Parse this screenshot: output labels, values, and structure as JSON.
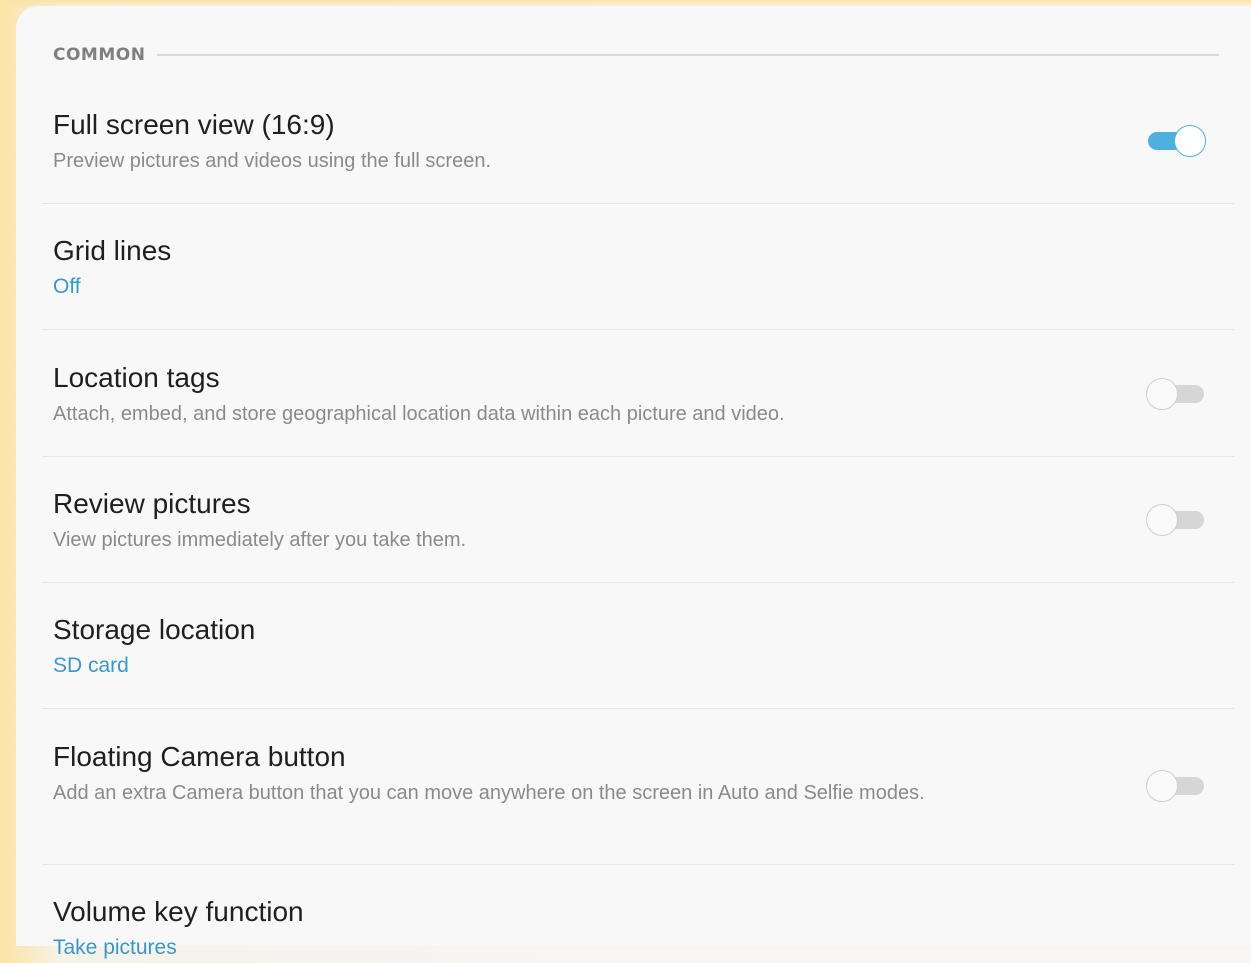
{
  "section": {
    "title": "COMMON"
  },
  "settings": [
    {
      "title": "Full screen view (16:9)",
      "description": "Preview pictures and videos using the full screen.",
      "toggle": "on"
    },
    {
      "title": "Grid lines",
      "value": "Off"
    },
    {
      "title": "Location tags",
      "description": "Attach, embed, and store geographical location data within each picture and video.",
      "toggle": "off"
    },
    {
      "title": "Review pictures",
      "description": "View pictures immediately after you take them.",
      "toggle": "off"
    },
    {
      "title": "Storage location",
      "value": "SD card"
    },
    {
      "title": "Floating Camera button",
      "description": "Add an extra Camera button that you can move anywhere on the screen in Auto and Selfie modes.",
      "toggle": "off"
    },
    {
      "title": "Volume key function",
      "value": "Take pictures"
    }
  ],
  "colors": {
    "accent": "#3a98c4",
    "toggle_on": "#4fb0df",
    "toggle_off": "#d6d6d6",
    "background_edge": "#fbe3a6",
    "panel": "#f8f8f8"
  }
}
